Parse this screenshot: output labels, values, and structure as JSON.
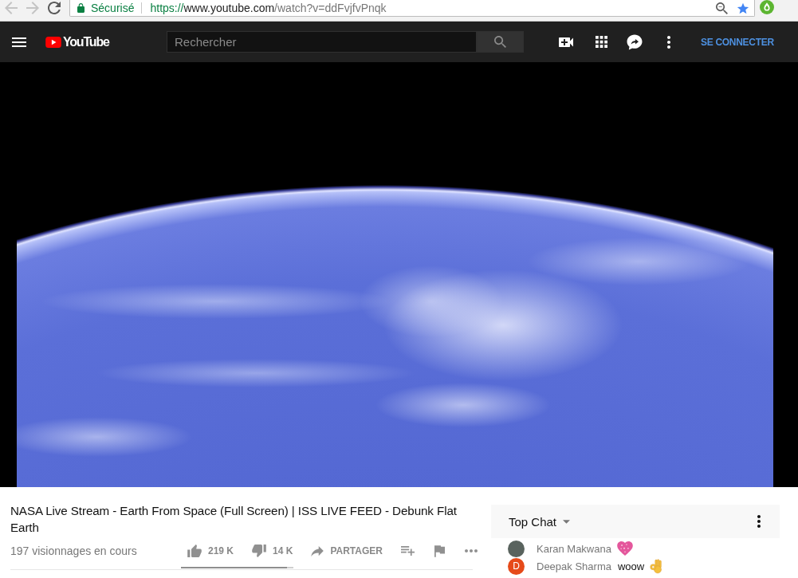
{
  "browser": {
    "nav": [
      {
        "kind": "back",
        "disabled": true
      },
      {
        "kind": "forward",
        "disabled": true
      },
      {
        "kind": "reload",
        "disabled": false
      }
    ],
    "security_label": "Sécurisé",
    "url": "https://www.youtube.com/watch?v=ddFvjfvPnqk",
    "bookmarked": true
  },
  "header": {
    "logo": "YouTube",
    "search": {
      "placeholder": "Rechercher"
    },
    "tools": [
      {
        "kind": "video_camera"
      },
      {
        "kind": "apps"
      },
      {
        "kind": "messages"
      },
      {
        "kind": "more"
      }
    ],
    "sign_in": "SE CONNECTER"
  },
  "video_info": {
    "title": "NASA Live Stream - Earth From Space (Full Screen) | ISS LIVE FEED - Debunk Flat Earth",
    "viewers": "197 visionnages en cours",
    "actions": [
      {
        "kind": "like",
        "label": "219 K"
      },
      {
        "kind": "dislike",
        "label": "14 K"
      },
      {
        "kind": "share",
        "label": "PARTAGER"
      },
      {
        "kind": "playlist_add"
      },
      {
        "kind": "flag"
      },
      {
        "kind": "more"
      }
    ],
    "sentiment": {
      "level": 0.94
    }
  },
  "chat": {
    "title": "Top Chat",
    "messages": [
      {
        "author": "Karan Makwana",
        "avatar": {
          "kind": "photo"
        },
        "emoji": {
          "kind": "heart"
        }
      },
      {
        "author": "Deepak Sharma",
        "avatar": {
          "kind": "letter",
          "letter": "D",
          "color": "#e64a19"
        },
        "text": "woow",
        "emoji": {
          "kind": "ok_hand"
        }
      }
    ]
  }
}
